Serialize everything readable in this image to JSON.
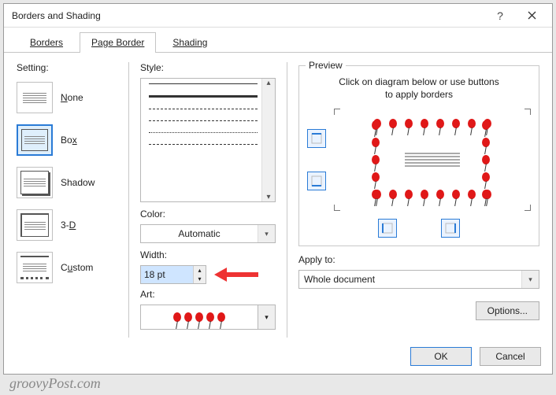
{
  "title": "Borders and Shading",
  "tabs": {
    "borders": "Borders",
    "pageBorder": "Page Border",
    "shading": "Shading"
  },
  "setting": {
    "label": "Setting:",
    "items": [
      {
        "label": "None",
        "ul": "N"
      },
      {
        "label": "Box",
        "ul": "x"
      },
      {
        "label": "Shadow",
        "ul": ""
      },
      {
        "label": "3-D",
        "ul": "D"
      },
      {
        "label": "Custom",
        "ul": "u"
      }
    ]
  },
  "style": {
    "label": "Style:",
    "colorLabel": "Color:",
    "colorValue": "Automatic",
    "widthLabel": "Width:",
    "widthValue": "18 pt",
    "artLabel": "Art:"
  },
  "preview": {
    "legend": "Preview",
    "hint1": "Click on diagram below or use buttons",
    "hint2": "to apply borders",
    "applyLabel": "Apply to:",
    "applyValue": "Whole document",
    "optionsLabel": "Options..."
  },
  "buttons": {
    "ok": "OK",
    "cancel": "Cancel"
  },
  "watermark": "groovyPost.com"
}
